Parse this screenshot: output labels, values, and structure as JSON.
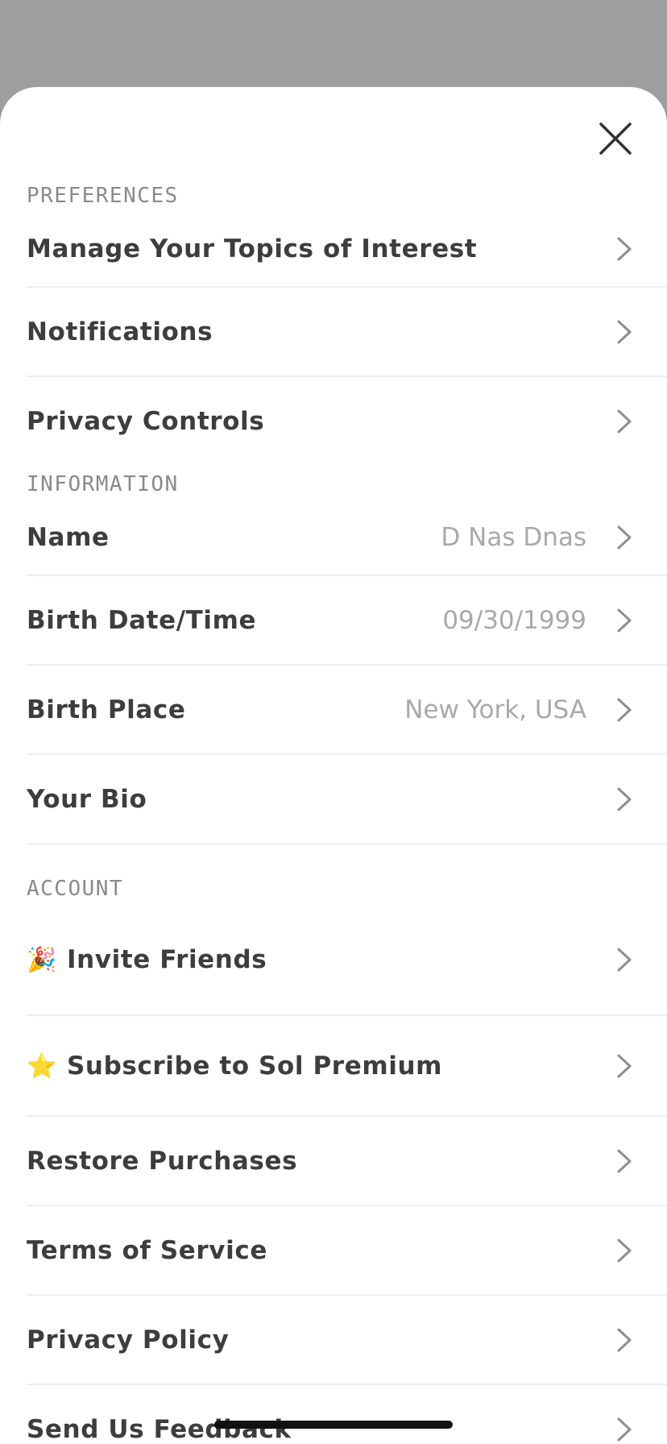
{
  "close_icon": "close-icon",
  "chevron_icon": "chevron-right-icon",
  "colors": {
    "backdrop": "#9e9e9e",
    "sheet": "#ffffff",
    "label": "#3d3d3d",
    "value": "#a9a9a9",
    "header": "#8a8a8a",
    "divider": "#eeeeee"
  },
  "sections": {
    "preferences": {
      "title": "PREFERENCES",
      "items": [
        {
          "label": "Manage Your Topics of Interest"
        },
        {
          "label": "Notifications"
        },
        {
          "label": "Privacy Controls"
        }
      ]
    },
    "information": {
      "title": "INFORMATION",
      "items": [
        {
          "label": "Name",
          "value": "D Nas Dnas"
        },
        {
          "label": "Birth Date/Time",
          "value": "09/30/1999"
        },
        {
          "label": "Birth Place",
          "value": "New York, USA"
        },
        {
          "label": "Your Bio"
        }
      ]
    },
    "account": {
      "title": "ACCOUNT",
      "items": [
        {
          "emoji": "🎉",
          "label": "Invite Friends"
        },
        {
          "emoji": "⭐",
          "label": "Subscribe to Sol Premium"
        },
        {
          "label": "Restore Purchases"
        },
        {
          "label": "Terms of Service"
        },
        {
          "label": "Privacy Policy"
        },
        {
          "label": "Send Us Feedback"
        }
      ]
    }
  }
}
